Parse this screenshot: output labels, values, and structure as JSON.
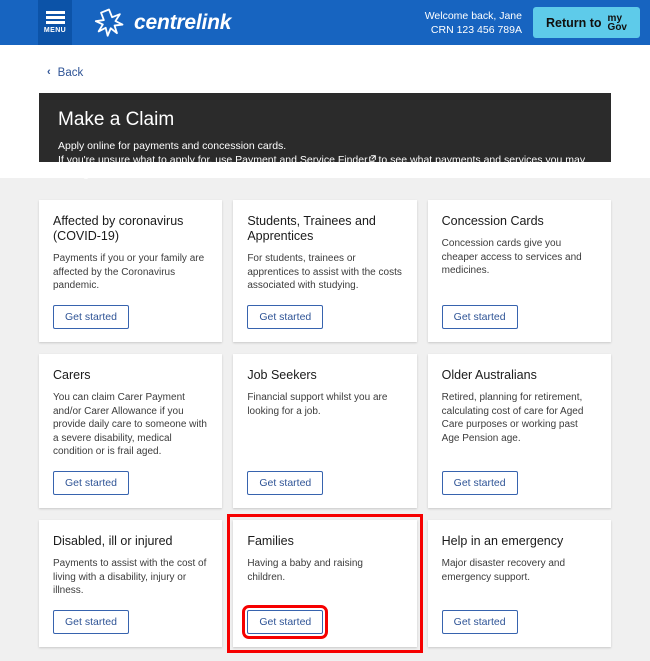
{
  "header": {
    "menu_label": "MENU",
    "brand_name": "centrelink",
    "welcome_line1": "Welcome back, Jane",
    "welcome_line2": "CRN 123 456 789A",
    "mygov_button": {
      "prefix": "Return to",
      "logo_line1": "my",
      "logo_line2": "Gov"
    },
    "brand_blue": "#1764c0",
    "mygov_cyan": "#5ecbea"
  },
  "back": {
    "label": "Back",
    "chevron": "back-chevron-icon"
  },
  "hero": {
    "title": "Make a Claim",
    "line1": "Apply online for payments and concession cards.",
    "line2_before": "If you're unsure what to apply for, use ",
    "link_text": "Payment and Service Finder",
    "line2_after": " to see what payments and services you may be eligible for.",
    "background": "#2b2b2b"
  },
  "cards": [
    {
      "title": "Affected by coronavirus (COVID-19)",
      "desc": "Payments if you or your family are affected by the Coronavirus pandemic.",
      "button": "Get started",
      "highlighted": false
    },
    {
      "title": "Students, Trainees and Apprentices",
      "desc": "For students, trainees or apprentices to assist with the costs associated with studying.",
      "button": "Get started",
      "highlighted": false
    },
    {
      "title": "Concession Cards",
      "desc": "Concession cards give you cheaper access to services and medicines.",
      "button": "Get started",
      "highlighted": false
    },
    {
      "title": "Carers",
      "desc": "You can claim Carer Payment and/or Carer Allowance if you provide daily care to someone with a severe disability, medical condition or is frail aged.",
      "button": "Get started",
      "highlighted": false
    },
    {
      "title": "Job Seekers",
      "desc": "Financial support whilst you are looking for a job.",
      "button": "Get started",
      "highlighted": false
    },
    {
      "title": "Older Australians",
      "desc": "Retired, planning for retirement, calculating cost of care for Aged Care purposes or working past Age Pension age.",
      "button": "Get started",
      "highlighted": false
    },
    {
      "title": "Disabled, ill or injured",
      "desc": "Payments to assist with the cost of living with a disability, injury or illness.",
      "button": "Get started",
      "highlighted": false
    },
    {
      "title": "Families",
      "desc": "Having a baby and raising children.",
      "button": "Get started",
      "highlighted": true
    },
    {
      "title": "Help in an emergency",
      "desc": "Major disaster recovery and emergency support.",
      "button": "Get started",
      "highlighted": false
    }
  ],
  "annotation": {
    "highlight_color": "#f60000",
    "target": "Families"
  }
}
